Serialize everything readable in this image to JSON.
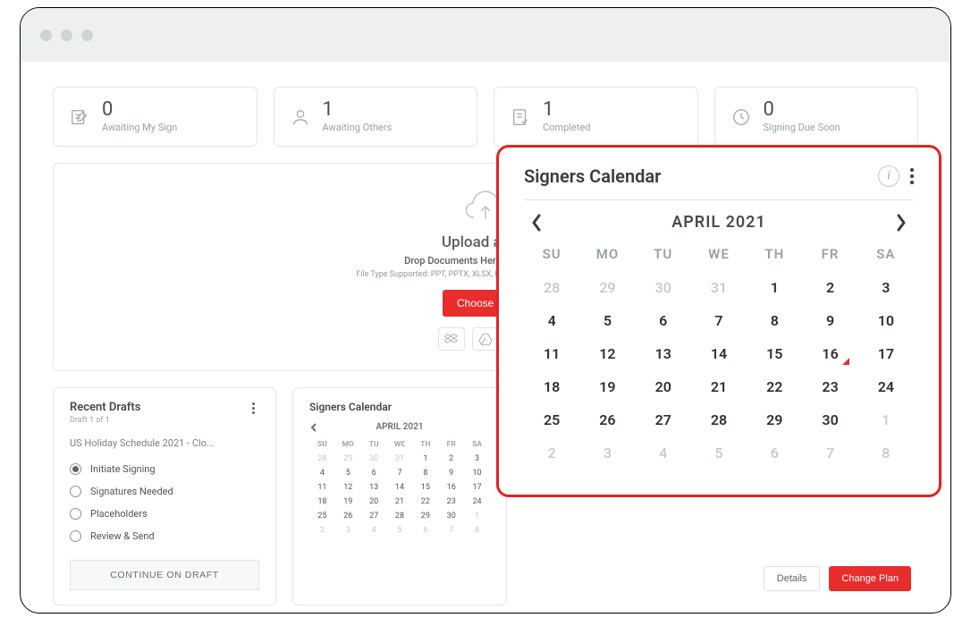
{
  "stats": [
    {
      "value": "0",
      "label": "Awaiting My Sign"
    },
    {
      "value": "1",
      "label": "Awaiting Others"
    },
    {
      "value": "1",
      "label": "Completed"
    },
    {
      "value": "0",
      "label": "Signing Due Soon"
    }
  ],
  "upload": {
    "title": "Upload a File",
    "subtitle": "Drop Documents Here To Get Started",
    "filetypes": "File Type Supported: PPT, PPTX, XLSX, DOCX, PDF, DOC, XLS, BMP, JPEG,",
    "choose": "Choose File"
  },
  "drafts": {
    "title": "Recent Drafts",
    "subtitle": "Draft 1 of 1",
    "doc": "US Holiday Schedule 2021 - Clo...",
    "steps": [
      "Initiate Signing",
      "Signatures Needed",
      "Placeholders",
      "Review & Send"
    ],
    "continue": "CONTINUE ON DRAFT"
  },
  "smallCal": {
    "title": "Signers Calendar",
    "month": "APRIL 2021",
    "headers": [
      "SU",
      "MO",
      "TU",
      "WE",
      "TH",
      "FR",
      "SA"
    ],
    "rows": [
      [
        {
          "n": "28",
          "m": true
        },
        {
          "n": "29",
          "m": true
        },
        {
          "n": "30",
          "m": true
        },
        {
          "n": "31",
          "m": true
        },
        {
          "n": "1"
        },
        {
          "n": "2"
        },
        {
          "n": "3"
        }
      ],
      [
        {
          "n": "4"
        },
        {
          "n": "5"
        },
        {
          "n": "6"
        },
        {
          "n": "7"
        },
        {
          "n": "8"
        },
        {
          "n": "9"
        },
        {
          "n": "10"
        }
      ],
      [
        {
          "n": "11"
        },
        {
          "n": "12"
        },
        {
          "n": "13"
        },
        {
          "n": "14"
        },
        {
          "n": "15"
        },
        {
          "n": "16"
        },
        {
          "n": "17"
        }
      ],
      [
        {
          "n": "18"
        },
        {
          "n": "19"
        },
        {
          "n": "20"
        },
        {
          "n": "21"
        },
        {
          "n": "22"
        },
        {
          "n": "23"
        },
        {
          "n": "24"
        }
      ],
      [
        {
          "n": "25"
        },
        {
          "n": "26"
        },
        {
          "n": "27"
        },
        {
          "n": "28"
        },
        {
          "n": "29"
        },
        {
          "n": "30"
        },
        {
          "n": "1",
          "m": true
        }
      ],
      [
        {
          "n": "2",
          "m": true
        },
        {
          "n": "3",
          "m": true
        },
        {
          "n": "4",
          "m": true
        },
        {
          "n": "5",
          "m": true
        },
        {
          "n": "6",
          "m": true
        },
        {
          "n": "7",
          "m": true
        },
        {
          "n": "8",
          "m": true
        }
      ]
    ]
  },
  "bigCal": {
    "title": "Signers Calendar",
    "month": "APRIL 2021",
    "headers": [
      "SU",
      "MO",
      "TU",
      "WE",
      "TH",
      "FR",
      "SA"
    ],
    "rows": [
      [
        {
          "n": "28",
          "m": true
        },
        {
          "n": "29",
          "m": true
        },
        {
          "n": "30",
          "m": true
        },
        {
          "n": "31",
          "m": true
        },
        {
          "n": "1"
        },
        {
          "n": "2"
        },
        {
          "n": "3"
        }
      ],
      [
        {
          "n": "4"
        },
        {
          "n": "5"
        },
        {
          "n": "6"
        },
        {
          "n": "7"
        },
        {
          "n": "8"
        },
        {
          "n": "9"
        },
        {
          "n": "10"
        }
      ],
      [
        {
          "n": "11"
        },
        {
          "n": "12"
        },
        {
          "n": "13"
        },
        {
          "n": "14"
        },
        {
          "n": "15"
        },
        {
          "n": "16",
          "mark": true
        },
        {
          "n": "17"
        }
      ],
      [
        {
          "n": "18"
        },
        {
          "n": "19"
        },
        {
          "n": "20"
        },
        {
          "n": "21"
        },
        {
          "n": "22"
        },
        {
          "n": "23"
        },
        {
          "n": "24"
        }
      ],
      [
        {
          "n": "25"
        },
        {
          "n": "26"
        },
        {
          "n": "27"
        },
        {
          "n": "28"
        },
        {
          "n": "29"
        },
        {
          "n": "30"
        },
        {
          "n": "1",
          "m": true
        }
      ],
      [
        {
          "n": "2",
          "m": true
        },
        {
          "n": "3",
          "m": true
        },
        {
          "n": "4",
          "m": true
        },
        {
          "n": "5",
          "m": true
        },
        {
          "n": "6",
          "m": true
        },
        {
          "n": "7",
          "m": true
        },
        {
          "n": "8",
          "m": true
        }
      ]
    ]
  },
  "actions": {
    "details": "Details",
    "change": "Change Plan"
  }
}
